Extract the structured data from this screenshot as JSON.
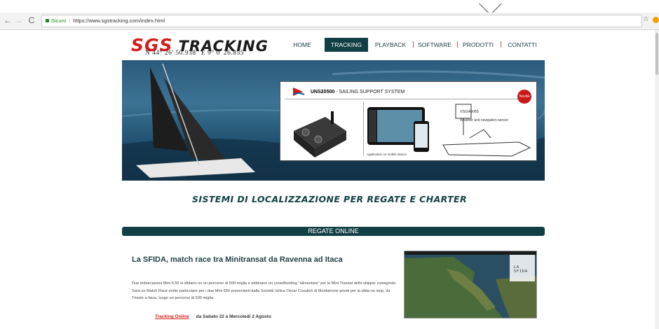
{
  "browser": {
    "secure_label": "Sicuro",
    "url": "https://www.sgstracking.com/index.html",
    "back_icon": "←",
    "forward_icon": "→",
    "reload_icon": "C",
    "star_icon": "☆"
  },
  "brand": {
    "logo_sgs": "SGS",
    "logo_tracking": "TRACKING",
    "coords": "N 44° 26' 50.938\"   E 9° 0' 26.855\""
  },
  "menu": {
    "items": [
      {
        "label": "HOME"
      },
      {
        "label": "TRACKING"
      },
      {
        "label": "PLAYBACK"
      },
      {
        "label": "SOFTWARE"
      },
      {
        "label": "PRODOTTI"
      },
      {
        "label": "CONTATTI"
      }
    ],
    "active": "TRACKING",
    "accent": "#123f45"
  },
  "banner": {
    "product_code": "UNS20500",
    "product_name": "SAILING SUPPORT SYSTEM",
    "badge": "Novità",
    "sensor_code": "VSG40065",
    "sensor_desc": "Weather and navigation sensor",
    "app_caption": "Application on mobile device"
  },
  "main": {
    "heading": "SISTEMI DI LOCALIZZAZIONE PER REGATE E CHARTER",
    "section_bar": "REGATE ONLINE",
    "news": {
      "title": "La SFIDA, match race tra Minitransat da Ravenna ad Itaca",
      "body": "Due imbarcazioni Mini 6.50 si sfidano su un percorso di 500 miglia e abbinano un crowdfunding \"alimentare\" per le Mini Transat dello skipper romagnolo. Sarà un Match Race molto particolare per i due Mini 650 provenienti dalla Società Velica Oscar Cosulich di Monfalcone pronti per la sfida no stop, da Trieste a Itaca, lungo un percorso di 500 miglia.",
      "link_label": "Tracking Online",
      "dates": "da Sabato 22 a Mercoledi 2 Agosto",
      "map_label": "LA SFIDA"
    }
  }
}
